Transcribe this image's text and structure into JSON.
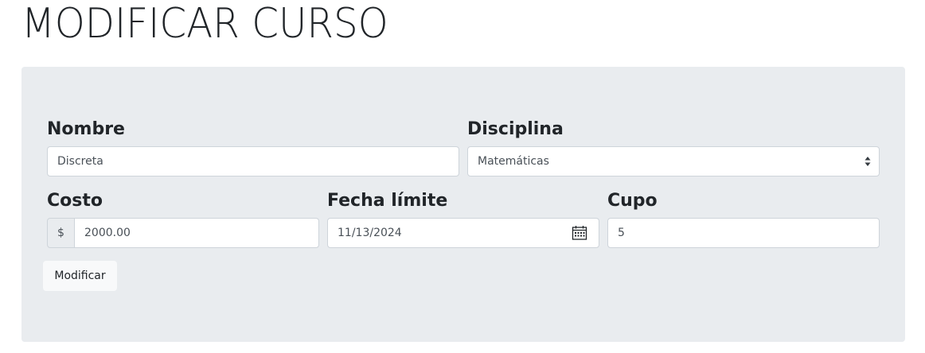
{
  "page": {
    "title": "MODIFICAR CURSO"
  },
  "form": {
    "nombre": {
      "label": "Nombre",
      "value": "Discreta"
    },
    "disciplina": {
      "label": "Disciplina",
      "selected": "Matemáticas"
    },
    "costo": {
      "label": "Costo",
      "prefix": "$",
      "value": "2000.00"
    },
    "fecha_limite": {
      "label": "Fecha límite",
      "value": "11/13/2024"
    },
    "cupo": {
      "label": "Cupo",
      "value": "5"
    },
    "submit_label": "Modificar"
  },
  "icons": {
    "select": "select-arrows-icon",
    "date": "calendar-icon"
  },
  "colors": {
    "panel_bg": "#e9ecef",
    "input_border": "#ced4da",
    "text": "#212529",
    "button_bg": "#f8f9fa"
  }
}
